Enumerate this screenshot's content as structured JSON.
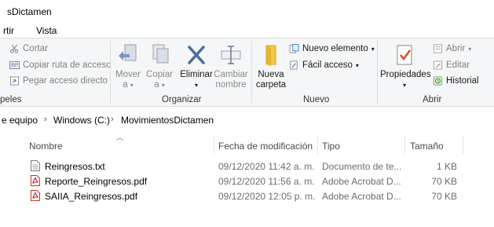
{
  "window": {
    "title": "sDictamen"
  },
  "menu": {
    "tabs": [
      "rtir",
      "Vista"
    ]
  },
  "ribbon": {
    "clipboard": {
      "cut": "Cortar",
      "copy_path": "Copiar ruta de acceso",
      "paste_shortcut": "Pegar acceso directo",
      "group_label": "peles"
    },
    "organize": {
      "move_line1": "Mover",
      "move_line2": "a",
      "copy_line1": "Copiar",
      "copy_line2": "a",
      "delete": "Eliminar",
      "rename_line1": "Cambiar",
      "rename_line2": "nombre",
      "group_label": "Organizar"
    },
    "new": {
      "new_folder_line1": "Nueva",
      "new_folder_line2": "carpeta",
      "new_item": "Nuevo elemento",
      "easy_access": "Fácil acceso",
      "group_label": "Nuevo"
    },
    "open": {
      "properties": "Propiedades",
      "open": "Abrir",
      "edit": "Editar",
      "history": "Historial",
      "group_label": "Abrir"
    }
  },
  "address": {
    "crumbs": [
      "e equipo",
      "Windows (C:)",
      "MovimientosDictamen"
    ]
  },
  "columns": {
    "name": "Nombre",
    "modified": "Fecha de modificación",
    "type": "Tipo",
    "size": "Tamaño"
  },
  "files": [
    {
      "name": "Reingresos.txt",
      "modified": "09/12/2020 11:42 a. m.",
      "type": "Documento de te...",
      "size": "1 KB",
      "icon": "text-file-icon"
    },
    {
      "name": "Reporte_Reingresos.pdf",
      "modified": "09/12/2020 11:56 a. m.",
      "type": "Adobe Acrobat D...",
      "size": "70 KB",
      "icon": "pdf-file-icon"
    },
    {
      "name": "SAIIA_Reingresos.pdf",
      "modified": "09/12/2020 12:05 p. m.",
      "type": "Adobe Acrobat D...",
      "size": "70 KB",
      "icon": "pdf-file-icon"
    }
  ]
}
